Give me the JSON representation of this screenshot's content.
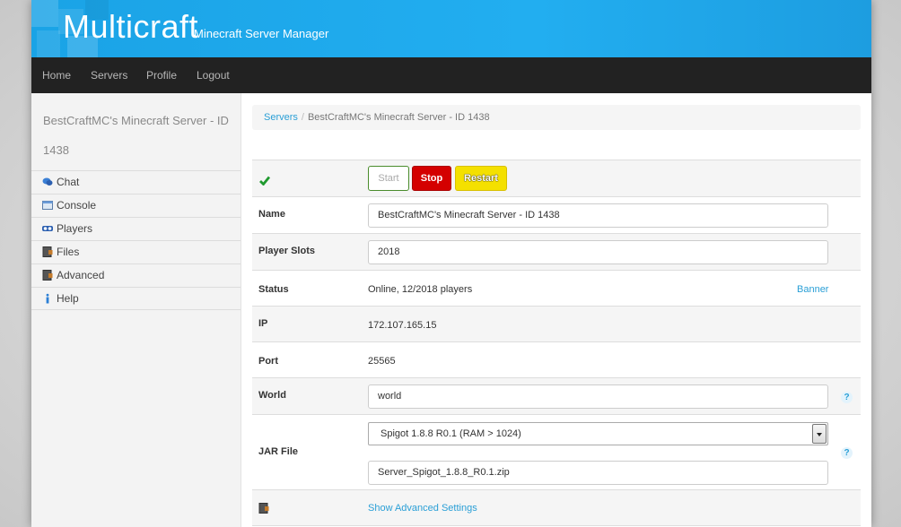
{
  "header": {
    "brand": "Multicraft",
    "tagline": "Minecraft Server Manager",
    "accent_color": "#1aa3e6"
  },
  "nav": {
    "items": [
      {
        "label": "Home"
      },
      {
        "label": "Servers"
      },
      {
        "label": "Profile"
      },
      {
        "label": "Logout"
      }
    ]
  },
  "sidebar": {
    "title": "BestCraftMC's Minecraft Server - ID 1438",
    "items": [
      {
        "label": "Chat",
        "icon": "chat-icon"
      },
      {
        "label": "Console",
        "icon": "console-icon"
      },
      {
        "label": "Players",
        "icon": "players-icon"
      },
      {
        "label": "Files",
        "icon": "files-icon"
      },
      {
        "label": "Advanced",
        "icon": "advanced-icon"
      },
      {
        "label": "Help",
        "icon": "info-icon"
      }
    ]
  },
  "breadcrumb": {
    "root": "Servers",
    "separator": "/",
    "current": "BestCraftMC's Minecraft Server - ID 1438"
  },
  "controls": {
    "status_icon": "check-icon",
    "start_label": "Start",
    "stop_label": "Stop",
    "restart_label": "Restart"
  },
  "fields": {
    "name_label": "Name",
    "name_value": "BestCraftMC's Minecraft Server - ID 1438",
    "slots_label": "Player Slots",
    "slots_value": "2018",
    "status_label": "Status",
    "status_value": "Online, 12/2018 players",
    "banner_link": "Banner",
    "ip_label": "IP",
    "ip_value": "172.107.165.15",
    "port_label": "Port",
    "port_value": "25565",
    "world_label": "World",
    "world_value": "world",
    "jar_label": "JAR File",
    "jar_selected": "Spigot 1.8.8 R0.1 (RAM > 1024)",
    "jar_filename": "Server_Spigot_1.8.8_R0.1.zip",
    "help_glyph": "?",
    "advanced_link": "Show Advanced Settings"
  }
}
